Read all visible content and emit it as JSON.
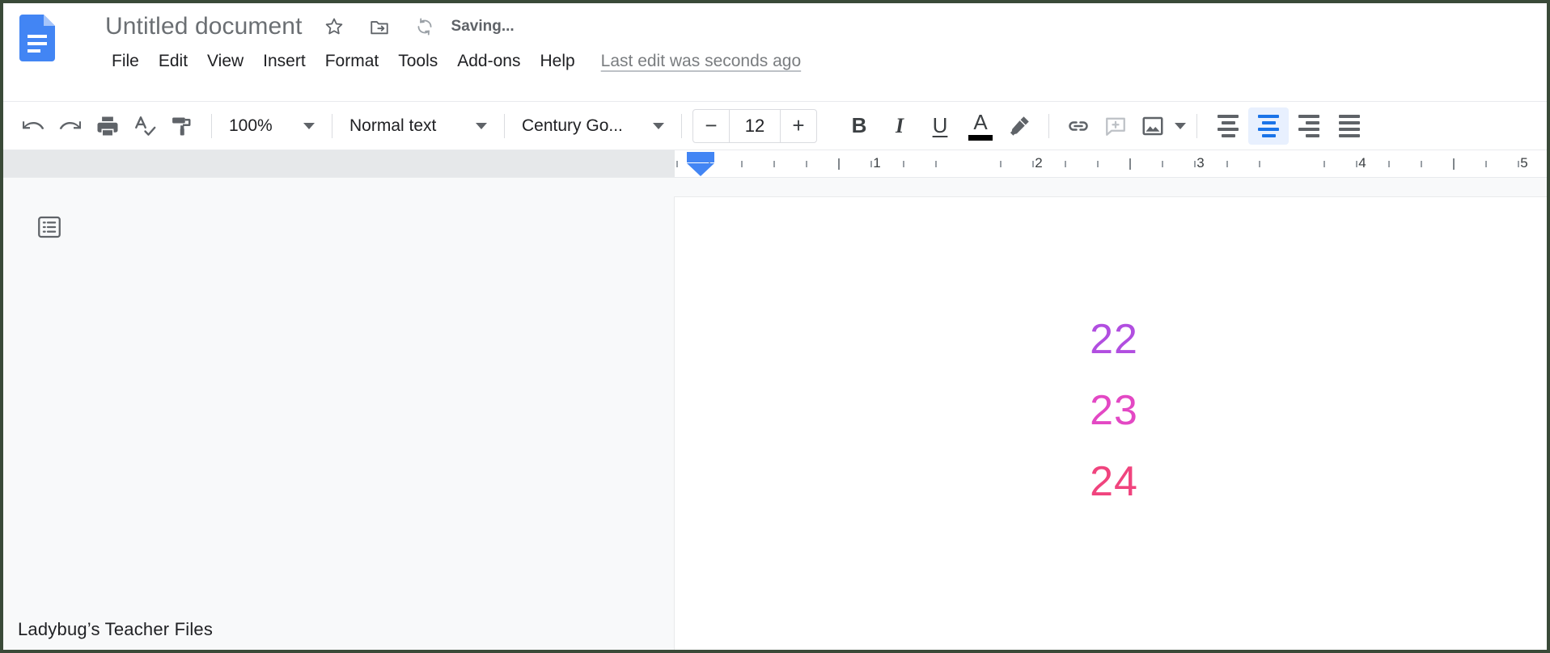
{
  "app": {
    "name": "Google Docs",
    "logo_icon": "google-docs-logo-icon"
  },
  "header": {
    "doc_title": "Untitled document",
    "star_icon": "star-outline-icon",
    "move_folder_icon": "move-to-folder-icon",
    "saving_icon": "cloud-sync-icon",
    "saving_status": "Saving...",
    "last_edit": "Last edit was seconds ago",
    "menu_items": [
      {
        "label": "File"
      },
      {
        "label": "Edit"
      },
      {
        "label": "View"
      },
      {
        "label": "Insert"
      },
      {
        "label": "Format"
      },
      {
        "label": "Tools"
      },
      {
        "label": "Add-ons"
      },
      {
        "label": "Help"
      }
    ]
  },
  "toolbar": {
    "undo_icon": "undo-icon",
    "redo_icon": "redo-icon",
    "print_icon": "print-icon",
    "spellcheck_icon": "spellcheck-icon",
    "paint_format_icon": "paint-format-icon",
    "zoom_value": "100%",
    "paragraph_style": "Normal text",
    "font_family": "Century Go...",
    "font_size": "12",
    "size_decrease": "−",
    "size_increase": "+",
    "bold_label": "B",
    "italic_label": "I",
    "underline_label": "U",
    "text_color_label": "A",
    "text_color_value": "#000000",
    "highlight_icon": "highlight-pen-icon",
    "link_icon": "insert-link-icon",
    "comment_icon": "add-comment-icon",
    "image_icon": "insert-image-icon",
    "align_left_icon": "align-left-icon",
    "align_center_icon": "align-center-icon",
    "align_right_icon": "align-right-icon",
    "align_justify_icon": "align-justify-icon",
    "active_alignment": "center",
    "accent_color": "#1a73e8",
    "active_bg_color": "#e8f0fe"
  },
  "ruler": {
    "numbers": [
      "1",
      "2",
      "3",
      "4",
      "5"
    ],
    "indent_marker_icon": "left-indent-marker-icon"
  },
  "document": {
    "outline_icon": "document-outline-icon",
    "lines": [
      {
        "text": "22",
        "color": "#b14ee0"
      },
      {
        "text": "23",
        "color": "#e348c4"
      },
      {
        "text": "24",
        "color": "#f0447e"
      }
    ]
  },
  "footer": {
    "caption": "Ladybug’s Teacher Files"
  }
}
